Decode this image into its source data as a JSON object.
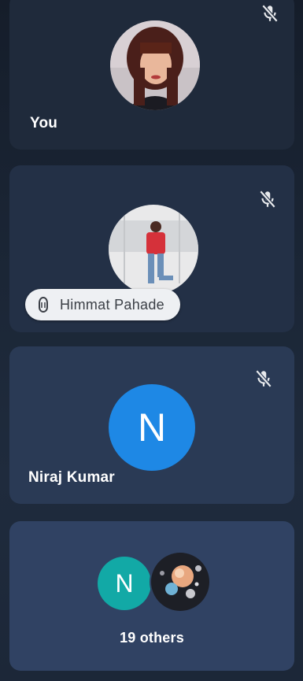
{
  "participants": [
    {
      "label": "You",
      "muted": true,
      "avatar": "photo-woman"
    },
    {
      "label": "Himmat Pahade",
      "muted": true,
      "avatar": "photo-man",
      "speaking_indicator": "hand-icon"
    },
    {
      "label": "Niraj Kumar",
      "muted": true,
      "avatar_letter": "N",
      "avatar_color": "#1e88e5"
    }
  ],
  "others": {
    "label": "19 others",
    "avatar_letter": "N",
    "avatar_color": "#12a9a6"
  },
  "colors": {
    "text_primary": "#ffffff",
    "pill_bg": "#eef0f3",
    "pill_text": "#3b3f46"
  }
}
